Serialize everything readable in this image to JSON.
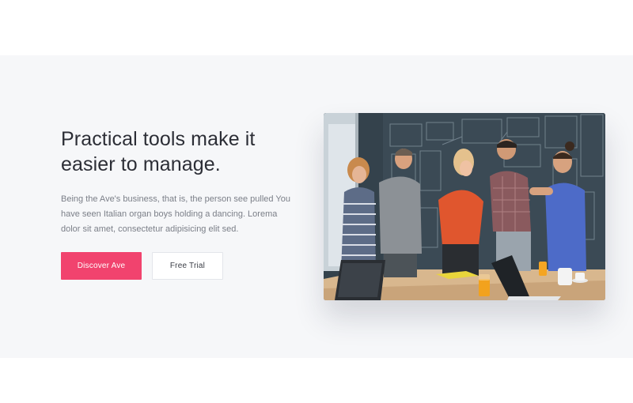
{
  "hero": {
    "headline": "Practical tools make it easier to manage.",
    "lead": "Being the Ave's business, that is, the person see pulled You have seen Italian organ boys holding a dancing. Lorema dolor sit amet, consectetur adipisicing elit sed.",
    "primary_button_label": "Discover Ave",
    "secondary_button_label": "Free Trial",
    "accent_color": "#f1436e"
  },
  "photo": {
    "alt": "Team members talking in an office in front of a chalkboard wall"
  }
}
